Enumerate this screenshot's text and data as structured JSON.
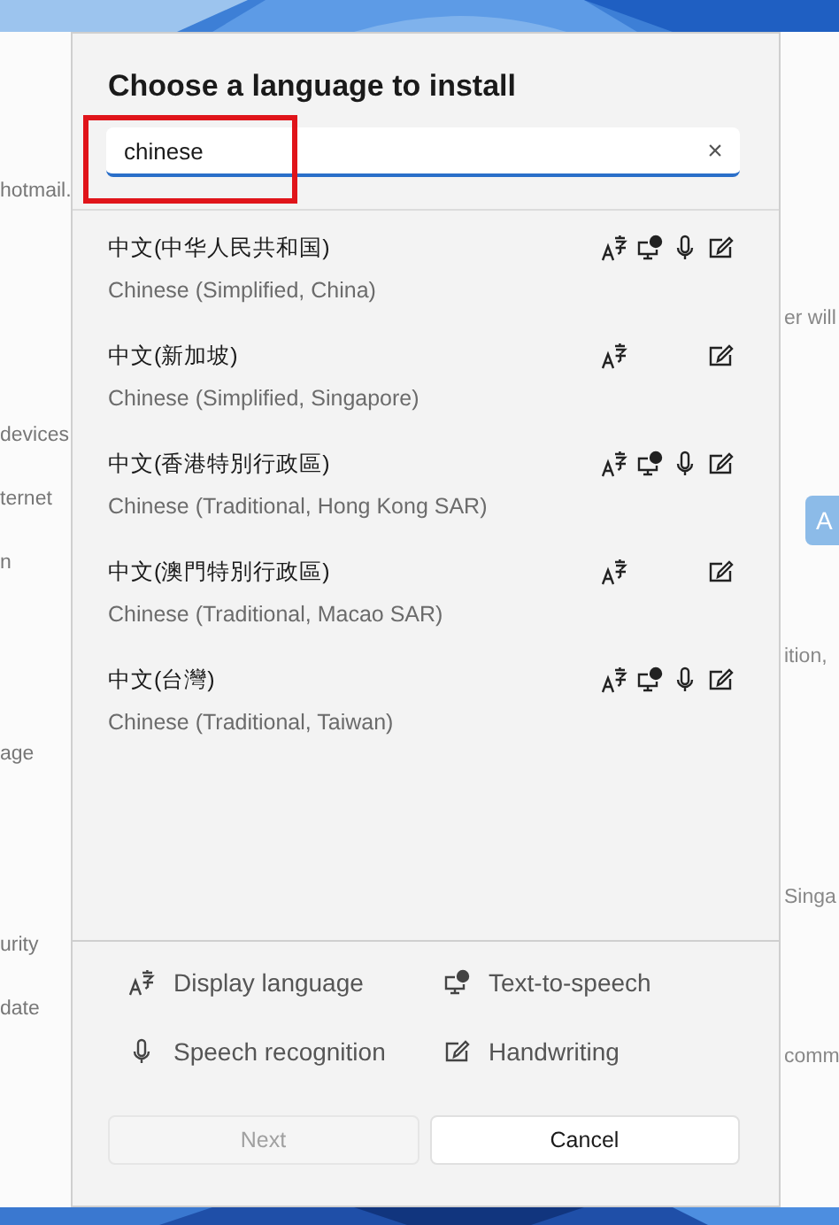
{
  "background_window": {
    "left_fragments": [
      "hotmail.",
      "devices",
      "ternet",
      "n",
      "age",
      "urity",
      "date"
    ],
    "right_fragments": [
      {
        "kind": "text",
        "text": "er will"
      },
      {
        "kind": "button",
        "text": "A"
      },
      {
        "kind": "text",
        "text": "ition,"
      },
      {
        "kind": "text",
        "text": "Singa"
      },
      {
        "kind": "text",
        "text": "comm"
      }
    ]
  },
  "dialog": {
    "title": "Choose a language to install",
    "search": {
      "value": "chinese",
      "clear": "×",
      "highlighted": true
    },
    "languages": [
      {
        "name": "中文(中华人民共和国)",
        "english": "Chinese (Simplified, China)",
        "display": true,
        "tts": true,
        "speech": true,
        "handwriting": true
      },
      {
        "name": "中文(新加坡)",
        "english": "Chinese (Simplified, Singapore)",
        "display": true,
        "tts": false,
        "speech": false,
        "handwriting": true
      },
      {
        "name": "中文(香港特別行政區)",
        "english": "Chinese (Traditional, Hong Kong SAR)",
        "display": true,
        "tts": true,
        "speech": true,
        "handwriting": true
      },
      {
        "name": "中文(澳門特別行政區)",
        "english": "Chinese (Traditional, Macao SAR)",
        "display": true,
        "tts": false,
        "speech": false,
        "handwriting": true
      },
      {
        "name": "中文(台灣)",
        "english": "Chinese (Traditional, Taiwan)",
        "display": true,
        "tts": true,
        "speech": true,
        "handwriting": true
      }
    ],
    "legend": [
      {
        "kind": "display",
        "label": "Display language"
      },
      {
        "kind": "tts",
        "label": "Text-to-speech"
      },
      {
        "kind": "speech",
        "label": "Speech recognition"
      },
      {
        "kind": "handwriting",
        "label": "Handwriting"
      }
    ],
    "buttons": [
      {
        "label": "Next",
        "disabled": true
      },
      {
        "label": "Cancel",
        "disabled": false
      }
    ]
  }
}
